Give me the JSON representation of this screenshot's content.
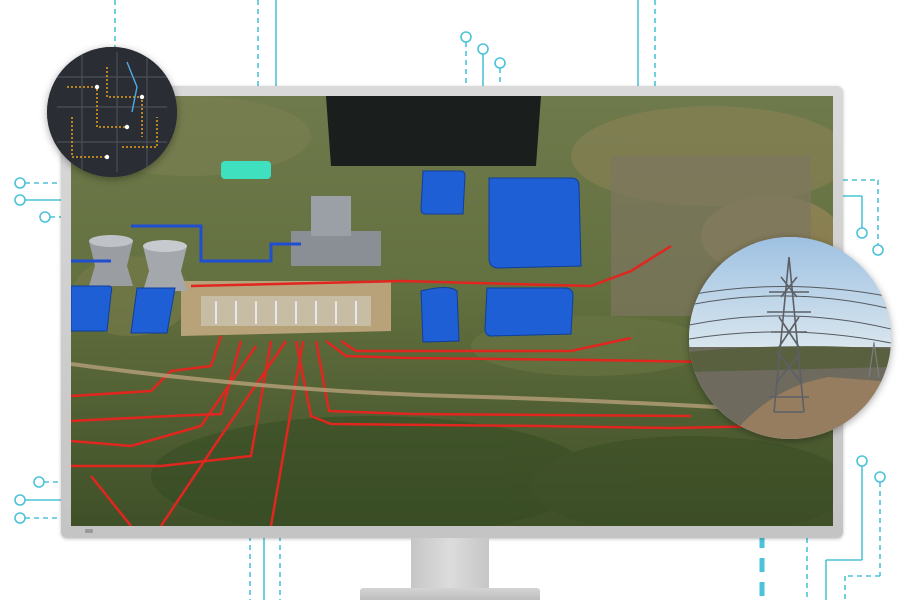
{
  "colors": {
    "circuit": "#4dc3d9",
    "monitor": "#cfcfcf",
    "pond": "#1f5fd6",
    "power_line": "#e0261e",
    "water_line": "#1f4fd0",
    "terrain": "#4c5a34"
  },
  "scene": {
    "pond_count": 6,
    "cooling_tower_count": 2
  },
  "icons": {
    "monitor": "monitor-icon",
    "network_inset": "network-map-icon",
    "tower_inset": "transmission-tower-icon"
  }
}
